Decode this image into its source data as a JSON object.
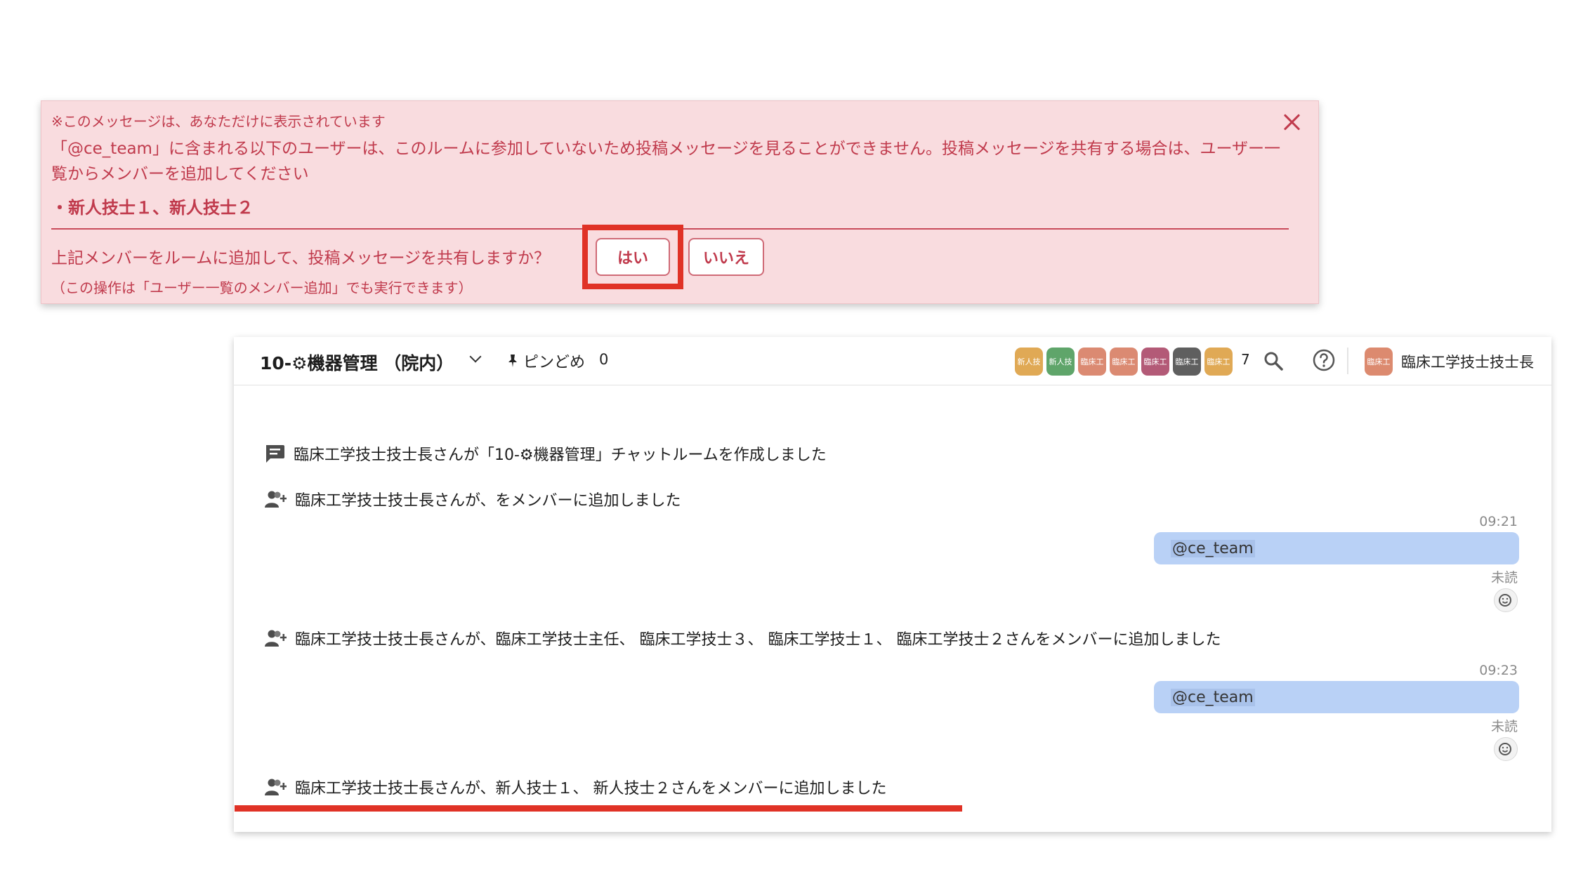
{
  "notice": {
    "small_text": "※このメッセージは、あなただけに表示されています",
    "body_text": "「@ce_team」に含まれる以下のユーザーは、このルームに参加していないため投稿メッセージを見ることができません。投稿メッセージを共有する場合は、ユーザー一覧からメンバーを追加してください",
    "users": "・新人技士１、新人技士２",
    "question": "上記メンバーをルームに追加して、投稿メッセージを共有しますか？",
    "note": "（この操作は「ユーザー一覧のメンバー追加」でも実行できます）",
    "yes_label": "はい",
    "no_label": "いいえ"
  },
  "header": {
    "room_title": "10-⚙機器管理 （院内）",
    "pin_label": "ピンどめ",
    "pin_count": "0",
    "member_count": "7",
    "members": [
      {
        "label": "新人技",
        "color": "#e0a955"
      },
      {
        "label": "新人技",
        "color": "#5fa56a"
      },
      {
        "label": "臨床工",
        "color": "#db8a72"
      },
      {
        "label": "臨床工",
        "color": "#db8a72"
      },
      {
        "label": "臨床工",
        "color": "#b35a77"
      },
      {
        "label": "臨床工",
        "color": "#5f5f5f"
      },
      {
        "label": "臨床工",
        "color": "#e0a955"
      }
    ],
    "user_avatar": "臨床工",
    "user_name": "臨床工学技士技士長"
  },
  "messages": {
    "event1": "臨床工学技士技士長さんが「10-⚙機器管理」チャットルームを作成しました",
    "event2": "臨床工学技士技士長さんが、をメンバーに追加しました",
    "msg1_time": "09:21",
    "msg1_text": "@ce_team",
    "msg1_status": "未読",
    "event3": "臨床工学技士技士長さんが、臨床工学技士主任、 臨床工学技士３、 臨床工学技士１、 臨床工学技士２さんをメンバーに追加しました",
    "msg2_time": "09:23",
    "msg2_text": "@ce_team",
    "msg2_status": "未読",
    "event4": "臨床工学技士技士長さんが、新人技士１、 新人技士２さんをメンバーに追加しました"
  }
}
